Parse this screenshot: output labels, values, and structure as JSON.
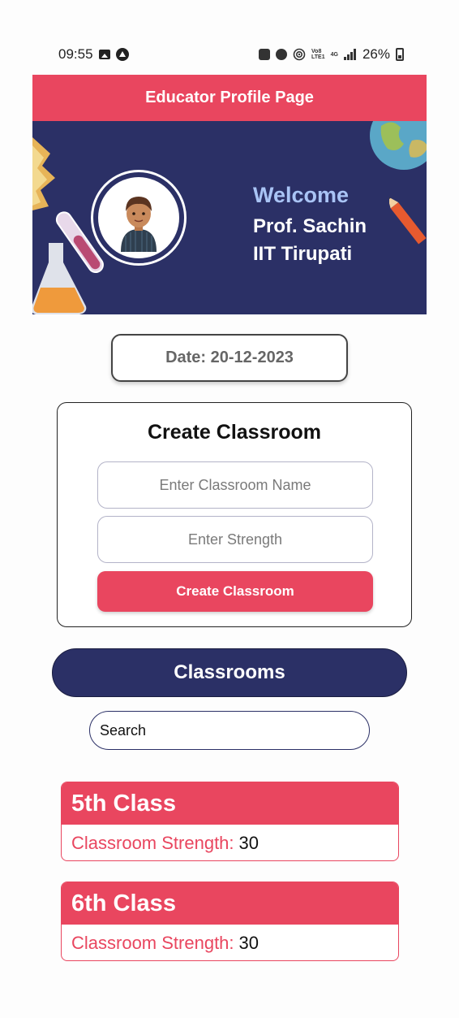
{
  "status_bar": {
    "time": "09:55",
    "battery": "26%",
    "net_top": "Vo8",
    "net_bottom": "LTE1",
    "net_type": "4G",
    "icons": [
      "gallery-icon",
      "app-circle-icon",
      "lock-icon",
      "alarm-icon",
      "hotspot-icon",
      "signal-icon",
      "battery-icon"
    ]
  },
  "header": {
    "title": "Educator Profile Page"
  },
  "banner": {
    "welcome": "Welcome",
    "name": "Prof. Sachin",
    "institution": "IIT Tirupati"
  },
  "date": {
    "label": "Date: 20-12-2023"
  },
  "create": {
    "title": "Create Classroom",
    "name_placeholder": "Enter Classroom Name",
    "strength_placeholder": "Enter Strength",
    "button_label": "Create Classroom"
  },
  "classrooms": {
    "title": "Classrooms",
    "search_placeholder": "Search",
    "items": [
      {
        "name": "5th Class",
        "strength_label": "Classroom Strength:",
        "strength": "30"
      },
      {
        "name": "6th Class",
        "strength_label": "Classroom Strength:",
        "strength": "30"
      }
    ]
  },
  "colors": {
    "accent": "#e9465f",
    "navy": "#2b3066",
    "welcome": "#a9c4f5"
  }
}
